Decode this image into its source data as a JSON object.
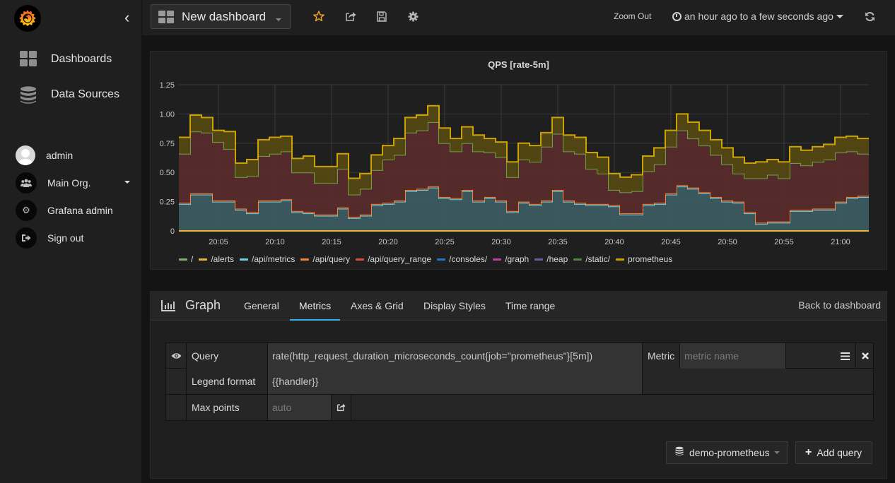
{
  "sidebar": {
    "logo": "grafana-logo",
    "nav": [
      {
        "label": "Dashboards",
        "icon": "dashboards-grid-icon"
      },
      {
        "label": "Data Sources",
        "icon": "database-icon"
      }
    ],
    "user": [
      {
        "label": "admin",
        "icon": "user-avatar-icon"
      },
      {
        "label": "Main Org.",
        "icon": "users-icon"
      },
      {
        "label": "Grafana admin",
        "icon": "gear-icon"
      },
      {
        "label": "Sign out",
        "icon": "sign-out-icon"
      }
    ]
  },
  "topbar": {
    "dashboard_title": "New dashboard",
    "zoom_out": "Zoom Out",
    "time_range": "an hour ago to a few seconds ago"
  },
  "panel": {
    "title": "QPS [rate-5m]"
  },
  "editor": {
    "panel_type": "Graph",
    "tabs": [
      "General",
      "Metrics",
      "Axes & Grid",
      "Display Styles",
      "Time range"
    ],
    "active_tab": "Metrics",
    "back": "Back to dashboard",
    "query_label": "Query",
    "query_value": "rate(http_request_duration_microseconds_count{job=\"prometheus\"}[5m])",
    "metric_label": "Metric",
    "metric_placeholder": "metric name",
    "legend_label": "Legend format",
    "legend_value": "{{handler}}",
    "maxpoints_label": "Max points",
    "maxpoints_placeholder": "auto",
    "datasource": "demo-prometheus",
    "add_query": "Add query"
  },
  "chart_data": {
    "type": "area",
    "stacked": true,
    "title": "QPS [rate-5m]",
    "xlabel": "",
    "ylabel": "",
    "x_ticks": [
      "20:05",
      "20:10",
      "20:15",
      "20:20",
      "20:25",
      "20:30",
      "20:35",
      "20:40",
      "20:45",
      "20:50",
      "20:55",
      "21:00"
    ],
    "y_ticks": [
      "0",
      "0.25",
      "0.50",
      "0.75",
      "1.00",
      "1.25"
    ],
    "ylim": [
      0,
      1.25
    ],
    "x_start": "20:01:30",
    "x_end": "21:02:30",
    "grid": true,
    "legend_position": "bottom",
    "legend": [
      {
        "name": "/",
        "color": "#7eb26d"
      },
      {
        "name": "/alerts",
        "color": "#eab839"
      },
      {
        "name": "/api/metrics",
        "color": "#6ed0e0"
      },
      {
        "name": "/api/query",
        "color": "#ef843c"
      },
      {
        "name": "/api/query_range",
        "color": "#e24d42"
      },
      {
        "name": "/consoles/",
        "color": "#1f78c1"
      },
      {
        "name": "/graph",
        "color": "#ba43a9"
      },
      {
        "name": "/heap",
        "color": "#705da0"
      },
      {
        "name": "/static/",
        "color": "#508642"
      },
      {
        "name": "prometheus",
        "color": "#cca300"
      }
    ],
    "x_minutes": [
      0,
      1,
      2,
      3,
      4,
      5,
      6,
      7,
      8,
      9,
      10,
      11,
      12,
      13,
      14,
      15,
      16,
      17,
      18,
      19,
      20,
      21,
      22,
      23,
      24,
      25,
      26,
      27,
      28,
      29,
      30,
      31,
      32,
      33,
      34,
      35,
      36,
      37,
      38,
      39,
      40,
      41,
      42,
      43,
      44,
      45,
      46,
      47,
      48,
      49,
      50,
      51,
      52,
      53,
      54,
      55,
      56,
      57,
      58,
      59,
      60
    ],
    "series": [
      {
        "name": "/api/metrics",
        "values": [
          0.23,
          0.31,
          0.31,
          0.25,
          0.25,
          0.18,
          0.15,
          0.25,
          0.25,
          0.26,
          0.16,
          0.15,
          0.13,
          0.13,
          0.19,
          0.11,
          0.13,
          0.22,
          0.23,
          0.25,
          0.34,
          0.35,
          0.37,
          0.28,
          0.27,
          0.34,
          0.25,
          0.28,
          0.25,
          0.16,
          0.24,
          0.22,
          0.25,
          0.34,
          0.25,
          0.23,
          0.22,
          0.22,
          0.21,
          0.14,
          0.14,
          0.22,
          0.23,
          0.31,
          0.38,
          0.36,
          0.32,
          0.28,
          0.25,
          0.24,
          0.15,
          0.06,
          0.07,
          0.07,
          0.17,
          0.17,
          0.18,
          0.18,
          0.24,
          0.28,
          0.29
        ]
      },
      {
        "name": "/api/query",
        "values": [
          0.01,
          0.01,
          0.01,
          0.01,
          0.01,
          0.01,
          0.01,
          0.01,
          0.01,
          0.01,
          0.01,
          0.01,
          0.01,
          0.01,
          0.01,
          0.01,
          0.01,
          0.01,
          0.01,
          0.01,
          0.01,
          0.01,
          0.01,
          0.01,
          0.01,
          0.01,
          0.01,
          0.01,
          0.01,
          0.01,
          0.01,
          0.01,
          0.01,
          0.01,
          0.01,
          0.01,
          0.01,
          0.01,
          0.01,
          0.01,
          0.01,
          0.01,
          0.01,
          0.01,
          0.01,
          0.01,
          0.01,
          0.01,
          0.01,
          0.01,
          0.01,
          0.01,
          0.01,
          0.01,
          0.01,
          0.01,
          0.01,
          0.01,
          0.01,
          0.01,
          0.01
        ]
      },
      {
        "name": "/api/query_range",
        "values": [
          0.42,
          0.53,
          0.52,
          0.5,
          0.44,
          0.27,
          0.31,
          0.38,
          0.4,
          0.41,
          0.33,
          0.34,
          0.27,
          0.27,
          0.33,
          0.19,
          0.22,
          0.29,
          0.37,
          0.39,
          0.49,
          0.5,
          0.55,
          0.46,
          0.4,
          0.4,
          0.42,
          0.38,
          0.37,
          0.29,
          0.36,
          0.36,
          0.46,
          0.48,
          0.42,
          0.42,
          0.3,
          0.26,
          0.13,
          0.18,
          0.19,
          0.28,
          0.33,
          0.4,
          0.47,
          0.42,
          0.4,
          0.36,
          0.31,
          0.24,
          0.29,
          0.38,
          0.4,
          0.37,
          0.4,
          0.38,
          0.4,
          0.42,
          0.42,
          0.39,
          0.36
        ]
      },
      {
        "name": "/",
        "values": [
          0,
          0,
          0,
          0,
          0,
          0,
          0,
          0,
          0,
          0,
          0,
          0,
          0,
          0,
          0,
          0,
          0,
          0,
          0,
          0,
          0,
          0,
          0,
          0,
          0,
          0,
          0,
          0,
          0,
          0,
          0,
          0,
          0,
          0,
          0,
          0,
          0,
          0,
          0,
          0,
          0,
          0,
          0,
          0,
          0,
          0,
          0,
          0,
          0,
          0,
          0,
          0,
          0,
          0,
          0,
          0,
          0,
          0,
          0,
          0,
          0
        ]
      },
      {
        "name": "/static/",
        "values": [
          0,
          0,
          0,
          0,
          0,
          0,
          0,
          0,
          0,
          0,
          0,
          0,
          0,
          0,
          0,
          0,
          0,
          0,
          0,
          0,
          0,
          0,
          0,
          0,
          0,
          0,
          0,
          0,
          0,
          0,
          0,
          0,
          0,
          0,
          0,
          0,
          0,
          0,
          0,
          0,
          0,
          0,
          0,
          0,
          0,
          0,
          0,
          0,
          0,
          0,
          0,
          0,
          0,
          0,
          0,
          0,
          0,
          0,
          0,
          0,
          0
        ]
      },
      {
        "name": "prometheus",
        "values": [
          0.14,
          0.14,
          0.13,
          0.1,
          0.15,
          0.12,
          0.14,
          0.14,
          0.14,
          0.13,
          0.12,
          0.14,
          0.14,
          0.14,
          0.13,
          0.14,
          0.13,
          0.13,
          0.12,
          0.14,
          0.13,
          0.13,
          0.14,
          0.13,
          0.11,
          0.14,
          0.14,
          0.12,
          0.13,
          0.13,
          0.14,
          0.14,
          0.12,
          0.14,
          0.14,
          0.14,
          0.14,
          0.14,
          0.14,
          0.13,
          0.14,
          0.13,
          0.14,
          0.14,
          0.14,
          0.14,
          0.13,
          0.13,
          0.14,
          0.14,
          0.13,
          0.14,
          0.13,
          0.14,
          0.14,
          0.13,
          0.13,
          0.13,
          0.13,
          0.13,
          0.13
        ]
      },
      {
        "name": "/alerts",
        "values": [
          0,
          0,
          0,
          0,
          0,
          0,
          0,
          0,
          0,
          0,
          0,
          0,
          0,
          0,
          0,
          0,
          0,
          0,
          0,
          0,
          0,
          0,
          0,
          0,
          0,
          0,
          0,
          0,
          0,
          0,
          0,
          0,
          0,
          0,
          0,
          0,
          0,
          0,
          0,
          0,
          0,
          0,
          0,
          0,
          0,
          0,
          0,
          0,
          0,
          0,
          0,
          0,
          0,
          0,
          0,
          0,
          0,
          0,
          0,
          0,
          0
        ]
      }
    ]
  }
}
